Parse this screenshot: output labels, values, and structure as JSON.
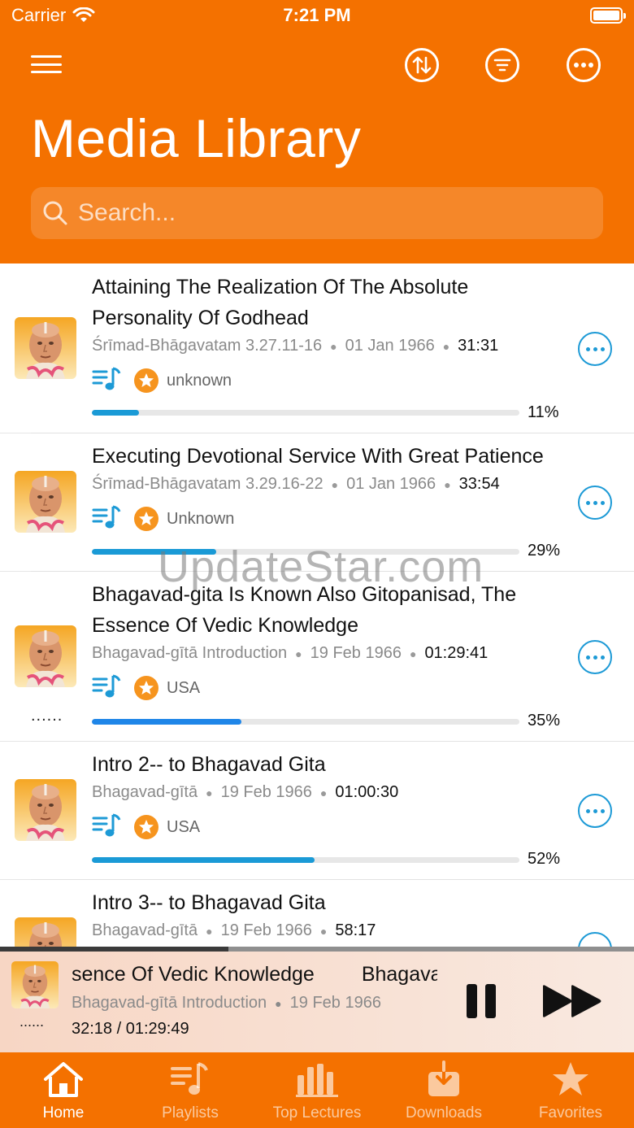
{
  "status_bar": {
    "carrier": "Carrier",
    "time": "7:21 PM"
  },
  "header": {
    "title": "Media Library",
    "search_placeholder": "Search...",
    "icons": [
      "menu-icon",
      "sort-icon",
      "filter-icon",
      "more-icon"
    ]
  },
  "colors": {
    "brand": "#f47100",
    "accent": "#1d9ad6",
    "star": "#f6941e",
    "progress_blue": "#1a9ad6"
  },
  "lectures": [
    {
      "title": "Attaining The Realization Of The Absolute Personality Of Godhead",
      "source": "Śrīmad-Bhāgavatam 3.27.11-16",
      "date": "01 Jan 1966",
      "duration": "31:31",
      "location": "unknown",
      "progress": 0.11,
      "progress_label": "11%"
    },
    {
      "title": "Executing Devotional Service With Great Patience",
      "source": "Śrīmad-Bhāgavatam 3.29.16-22",
      "date": "01 Jan 1966",
      "duration": "33:54",
      "location": "Unknown",
      "progress": 0.29,
      "progress_label": "29%"
    },
    {
      "title": "Bhagavad-gita Is Known Also Gitopanisad, The Essence Of Vedic Knowledge",
      "source": "Bhagavad-gītā Introduction",
      "date": "19 Feb 1966",
      "duration": "01:29:41",
      "location": "USA",
      "progress": 0.35,
      "progress_label": "35%",
      "playing_indicator": "......"
    },
    {
      "title": "Intro 2-- to Bhagavad Gita",
      "source": "Bhagavad-gītā",
      "date": "19 Feb 1966",
      "duration": "01:00:30",
      "location": "USA",
      "progress": 0.52,
      "progress_label": "52%"
    },
    {
      "title": "Intro 3-- to Bhagavad Gita",
      "source": "Bhagavad-gītā",
      "date": "19 Feb 1966",
      "duration": "58:17"
    }
  ],
  "watermark": "UpdateStar.com",
  "player": {
    "title_scroll_a": "sence Of Vedic Knowledge",
    "title_scroll_b": "Bhagavad-gi",
    "source": "Bhagavad-gītā Introduction",
    "date": "19 Feb 1966",
    "time": "32:18  /  01:29:49",
    "indicator": "......",
    "progress": 0.36
  },
  "tabs": [
    {
      "label": "Home",
      "icon": "home-icon",
      "active": true
    },
    {
      "label": "Playlists",
      "icon": "playlist-icon",
      "active": false
    },
    {
      "label": "Top Lectures",
      "icon": "bar-chart-icon",
      "active": false
    },
    {
      "label": "Downloads",
      "icon": "download-icon",
      "active": false
    },
    {
      "label": "Favorites",
      "icon": "star-icon",
      "active": false
    }
  ]
}
